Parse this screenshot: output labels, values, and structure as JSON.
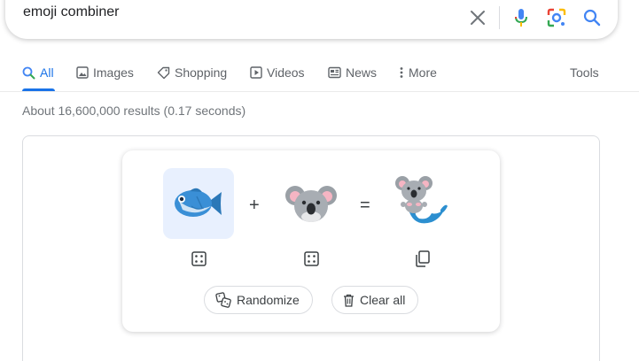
{
  "search": {
    "query": "emoji combiner"
  },
  "tabs": [
    {
      "label": "All",
      "icon": "search-icon",
      "active": true
    },
    {
      "label": "Images",
      "icon": "image-icon"
    },
    {
      "label": "Shopping",
      "icon": "tag-icon"
    },
    {
      "label": "Videos",
      "icon": "play-icon"
    },
    {
      "label": "News",
      "icon": "news-icon"
    },
    {
      "label": "More",
      "icon": "more-vert-icon"
    }
  ],
  "tools_label": "Tools",
  "results_stats": "About 16,600,000 results (0.17 seconds)",
  "emoji_kitchen": {
    "left_emoji": "fish",
    "right_emoji": "koala",
    "result_emoji": "koala-mermaid",
    "plus": "+",
    "equals": "=",
    "randomize_label": "Randomize",
    "clear_label": "Clear all"
  },
  "colors": {
    "accent": "#1a73e8",
    "selected_bg": "#e8f0fe"
  }
}
